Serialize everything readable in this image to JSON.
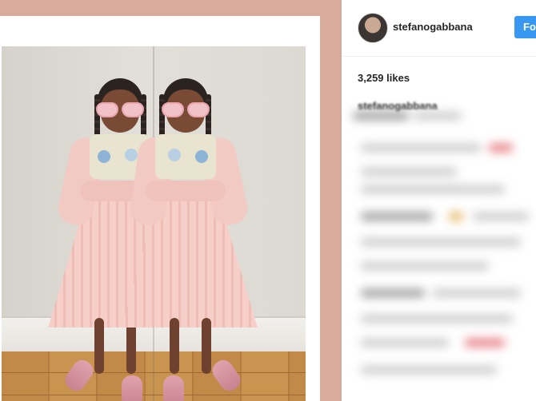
{
  "post": {
    "username": "stefanogabbana",
    "follow_label": "Fo",
    "likes": "3,259 likes",
    "caption_user": "stefanogabbana"
  },
  "icons": {
    "avatar": "profile-avatar"
  },
  "colors": {
    "frame": "#d9ab9c",
    "follow": "#3897f0"
  }
}
